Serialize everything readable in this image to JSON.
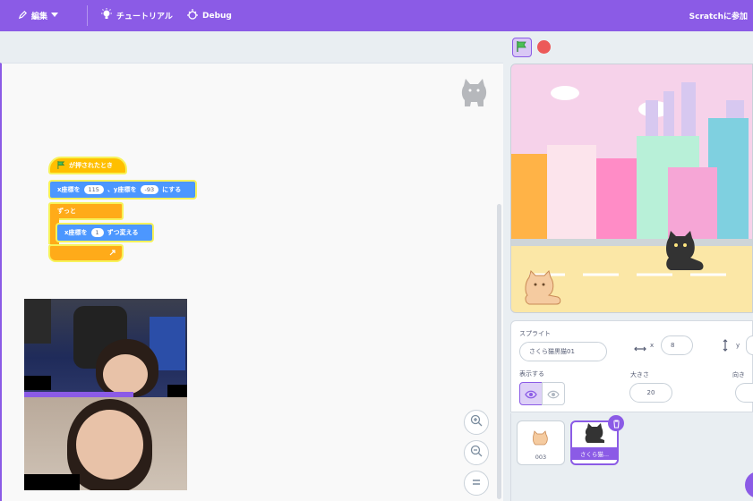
{
  "menubar": {
    "edit_label": "編集",
    "tutorial_label": "チュートリアル",
    "debug_label": "Debug",
    "join_label": "Scratchに参加"
  },
  "blocks": {
    "hat_label": "が押されたとき",
    "motion1": {
      "x_label": "x座標を",
      "x_value": "115",
      "y_label": "、y座標を",
      "y_value": "-93",
      "suffix": "にする"
    },
    "forever_label": "ずっと",
    "motion2": {
      "label": "x座標を",
      "value": "1",
      "suffix": "ずつ変える"
    }
  },
  "sprite_info": {
    "heading": "スプライト",
    "name_value": "さくら猫黒猫01",
    "x_label": "x",
    "x_value": "8",
    "y_label": "y",
    "show_label": "表示する",
    "size_label": "大きさ",
    "size_value": "20",
    "direction_label": "向き"
  },
  "sprites": [
    {
      "name": "003"
    },
    {
      "name": "さくら猫..."
    }
  ],
  "colors": {
    "accent": "#8b5be6",
    "hat": "#ffbf00",
    "motion": "#4c97ff",
    "control": "#ffab19",
    "stop": "#ec5959"
  }
}
